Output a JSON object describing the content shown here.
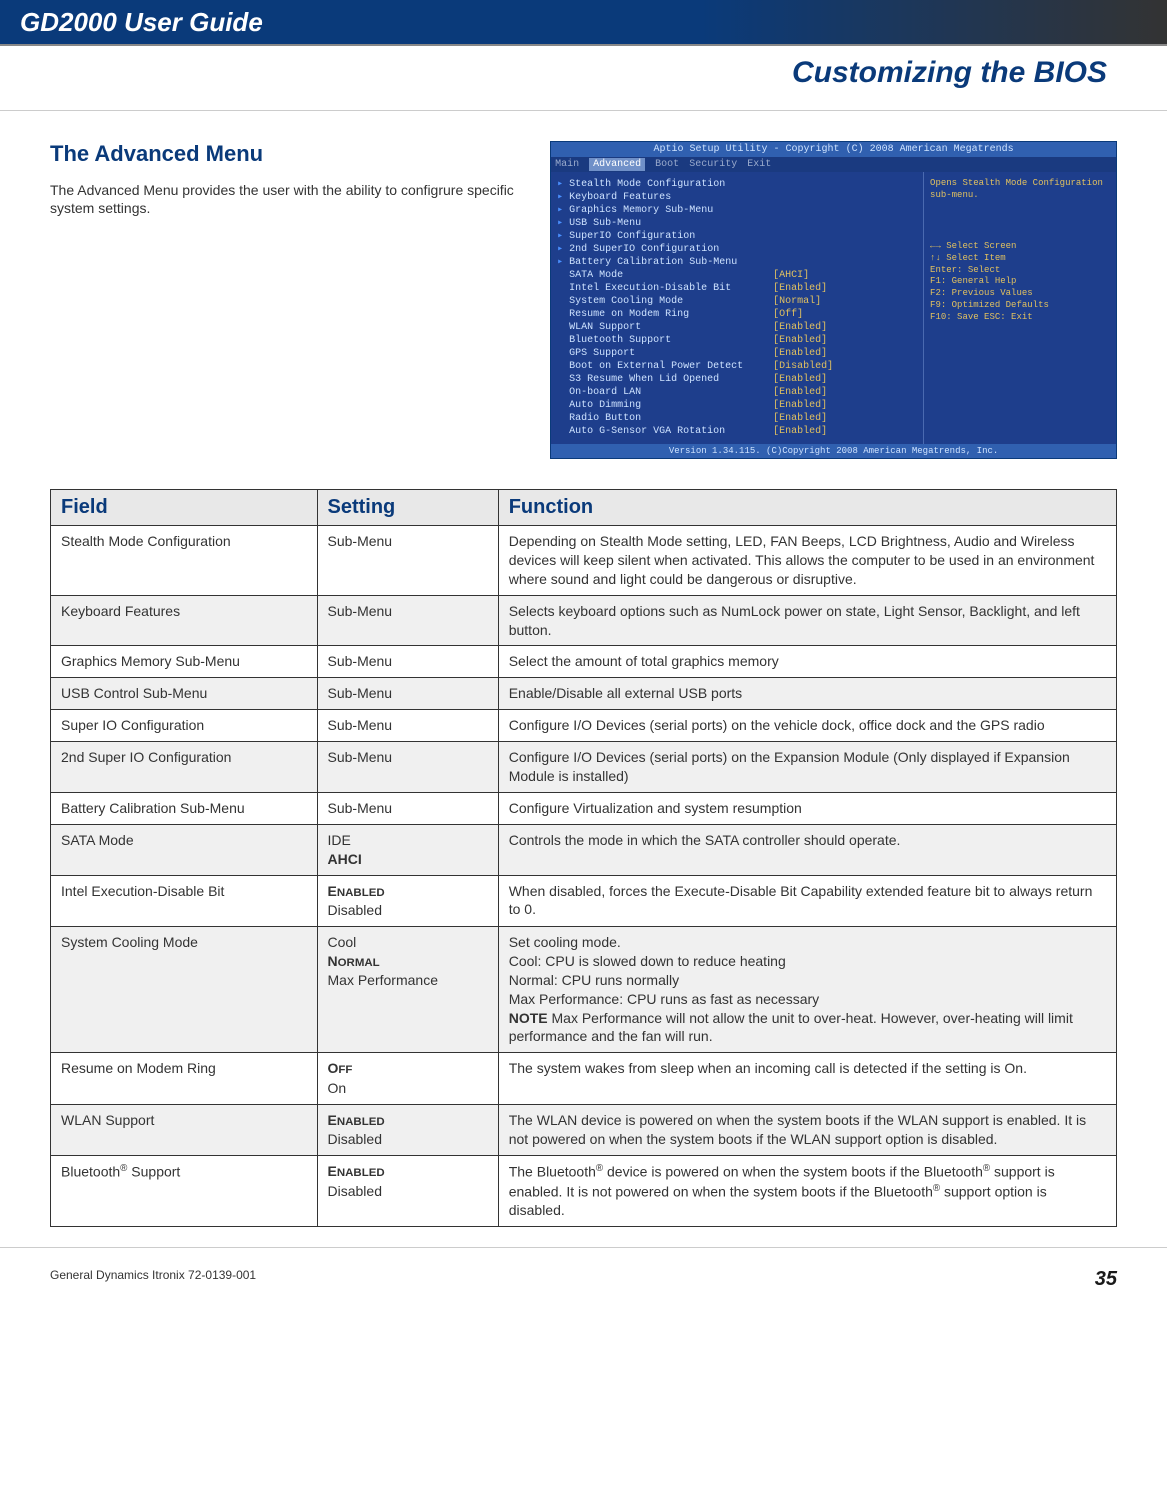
{
  "header": {
    "guide_title": "GD2000 User Guide",
    "section_title": "Customizing the BIOS"
  },
  "section": {
    "heading": "The Advanced Menu",
    "body": "The Advanced Menu provides the user with the ability to configrure specific system settings."
  },
  "bios": {
    "top": "Aptio Setup Utility - Copyright (C) 2008 American Megatrends",
    "menu": [
      "Main",
      "Advanced",
      "Boot",
      "Security",
      "Exit"
    ],
    "selected_menu": "Advanced",
    "help_top": "Opens Stealth Mode Configuration sub-menu.",
    "help_keys": [
      "←→  Select Screen",
      "↑↓  Select Item",
      "Enter: Select",
      "F1: General Help",
      "F2: Previous Values",
      "F9: Optimized Defaults",
      "F10: Save ESC: Exit"
    ],
    "rows": [
      {
        "name": "Stealth Mode Configuration",
        "val": "",
        "menu": true
      },
      {
        "name": "Keyboard Features",
        "val": "",
        "menu": true
      },
      {
        "name": "Graphics Memory Sub-Menu",
        "val": "",
        "menu": true
      },
      {
        "name": "USB Sub-Menu",
        "val": "",
        "menu": true
      },
      {
        "name": "SuperIO Configuration",
        "val": "",
        "menu": true
      },
      {
        "name": "2nd SuperIO Configuration",
        "val": "",
        "menu": true
      },
      {
        "name": "Battery Calibration Sub-Menu",
        "val": "",
        "menu": true
      },
      {
        "name": "SATA Mode",
        "val": "[AHCI]"
      },
      {
        "name": "Intel Execution-Disable Bit",
        "val": "[Enabled]"
      },
      {
        "name": "System Cooling Mode",
        "val": "[Normal]"
      },
      {
        "name": "Resume on Modem Ring",
        "val": "[Off]"
      },
      {
        "name": "WLAN Support",
        "val": "[Enabled]"
      },
      {
        "name": "Bluetooth Support",
        "val": "[Enabled]"
      },
      {
        "name": "GPS Support",
        "val": "[Enabled]"
      },
      {
        "name": "Boot on External Power Detect",
        "val": "[Disabled]"
      },
      {
        "name": "S3 Resume When Lid Opened",
        "val": "[Enabled]"
      },
      {
        "name": "On-board LAN",
        "val": "[Enabled]"
      },
      {
        "name": "Auto Dimming",
        "val": "[Enabled]"
      },
      {
        "name": "Radio Button",
        "val": "[Enabled]"
      },
      {
        "name": "Auto G-Sensor VGA Rotation",
        "val": "[Enabled]"
      }
    ],
    "bottom": "Version 1.34.115. (C)Copyright 2008 American Megatrends, Inc."
  },
  "table": {
    "headers": [
      "Field",
      "Setting",
      "Function"
    ],
    "rows": [
      {
        "field": "Stealth Mode Configuration",
        "setting": [
          "Sub-Menu"
        ],
        "default_idx": -1,
        "function": "Depending on Stealth Mode setting, LED, FAN Beeps, LCD Brightness, Audio and Wireless devices will keep silent when activated.  This allows the computer to be used in an environment where sound and light could be dangerous or disruptive."
      },
      {
        "field": "Keyboard Features",
        "setting": [
          "Sub-Menu"
        ],
        "default_idx": -1,
        "function": "Selects keyboard options such as NumLock power on state, Light Sensor, Backlight, and left button."
      },
      {
        "field": "Graphics Memory Sub-Menu",
        "setting": [
          "Sub-Menu"
        ],
        "default_idx": -1,
        "function": "Select the amount of total graphics memory"
      },
      {
        "field": "USB Control Sub-Menu",
        "setting": [
          "Sub-Menu"
        ],
        "default_idx": -1,
        "function": "Enable/Disable all external USB ports"
      },
      {
        "field": "Super IO Configuration",
        "setting": [
          "Sub-Menu"
        ],
        "default_idx": -1,
        "function": "Configure I/O Devices (serial ports) on the vehicle dock, office dock and the GPS radio"
      },
      {
        "field": "2nd Super IO Configuration",
        "setting": [
          "Sub-Menu"
        ],
        "default_idx": -1,
        "function": "Configure I/O Devices (serial ports) on the Expansion Module (Only displayed if Expansion Module is installed)"
      },
      {
        "field": "Battery Calibration Sub-Menu",
        "setting": [
          "Sub-Menu"
        ],
        "default_idx": -1,
        "function": "Configure Virtualization and system resumption"
      },
      {
        "field": "SATA Mode",
        "setting": [
          "IDE",
          "AHCI"
        ],
        "default_idx": 1,
        "function": "Controls the mode in which the SATA controller should operate."
      },
      {
        "field": "Intel Execution-Disable Bit",
        "setting": [
          "Enabled",
          "Disabled"
        ],
        "default_idx": 0,
        "smallcaps": true,
        "function": "When disabled, forces the Execute-Disable Bit Capability extended feature bit to always return to 0."
      },
      {
        "field": "System Cooling Mode",
        "setting": [
          "Cool",
          "Normal",
          "Max Performance"
        ],
        "default_idx": 1,
        "smallcaps": true,
        "function": "Set cooling mode.\nCool:  CPU is slowed down to reduce heating\nNormal:  CPU runs normally\nMax Performance:  CPU runs as fast as necessary\nNOTE  Max Performance will not  allow the unit to over-heat.  However,  over-heating will limit performance and the fan will run."
      },
      {
        "field": "Resume on Modem Ring",
        "setting": [
          "Off",
          "On"
        ],
        "default_idx": 0,
        "smallcaps": true,
        "function": "The system wakes from sleep when an incoming call is detected if the setting is On."
      },
      {
        "field": "WLAN Support",
        "setting": [
          "Enabled",
          "Disabled"
        ],
        "default_idx": 0,
        "smallcaps": true,
        "function": "The WLAN device is powered on when the system boots if the WLAN support is enabled.  It is not powered on when the system boots if the WLAN support option is disabled."
      },
      {
        "field": "Bluetooth® Support",
        "setting": [
          "Enabled",
          "Disabled"
        ],
        "default_idx": 0,
        "smallcaps": true,
        "function": "The Bluetooth® device is powered on when the system boots if the Bluetooth® support is enabled.  It is not powered on when the system boots if the Bluetooth® support option is disabled."
      }
    ]
  },
  "footer": {
    "left": "General Dynamics Itronix 72-0139-001",
    "page": "35"
  }
}
